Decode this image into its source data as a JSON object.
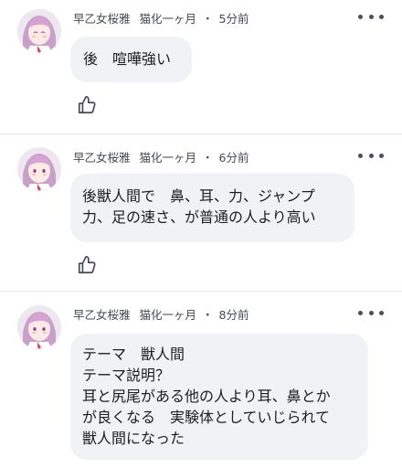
{
  "comments": [
    {
      "author": "早乙女桜雅",
      "status": "猫化一ヶ月",
      "time": "5分前",
      "lines": [
        "後　喧嘩強い"
      ]
    },
    {
      "author": "早乙女桜雅",
      "status": "猫化一ヶ月",
      "time": "6分前",
      "lines": [
        "後獣人間で　鼻、耳、力、ジャンプ",
        "力、足の速さ、が普通の人より高い"
      ]
    },
    {
      "author": "早乙女桜雅",
      "status": "猫化一ヶ月",
      "time": "8分前",
      "lines": [
        "テーマ　獣人間",
        "テーマ説明？",
        "耳と尻尾がある他の人より耳、鼻とか",
        "が良くなる　実験体としていじられて",
        "獣人間になった"
      ]
    }
  ],
  "separator": "・",
  "icons": {
    "more": "more-horizontal-icon",
    "like": "thumbs-up-icon",
    "avatar": "anime-avatar"
  },
  "colors": {
    "bubble": "#f0f2f5",
    "meta_text": "#444950",
    "divider": "#e4e6ea"
  }
}
